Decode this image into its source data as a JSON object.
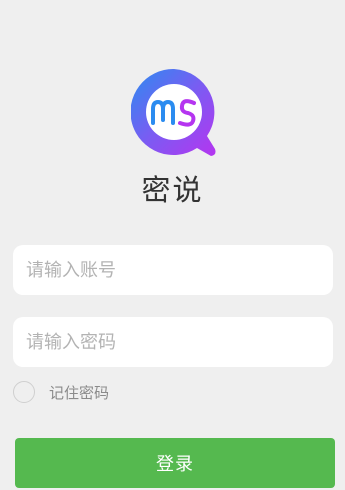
{
  "app": {
    "name": "密说"
  },
  "logo": {
    "icon": "chat-bubble-logo-icon",
    "text": "MS"
  },
  "form": {
    "username_placeholder": "请输入账号",
    "username_value": "",
    "password_placeholder": "请输入密码",
    "password_value": "",
    "remember_label": "记住密码",
    "remember_checked": false,
    "login_label": "登录"
  },
  "colors": {
    "background": "#efefef",
    "primary_button": "#55b94f",
    "logo_gradient_start": "#2b8cf0",
    "logo_gradient_end": "#b535f0"
  }
}
